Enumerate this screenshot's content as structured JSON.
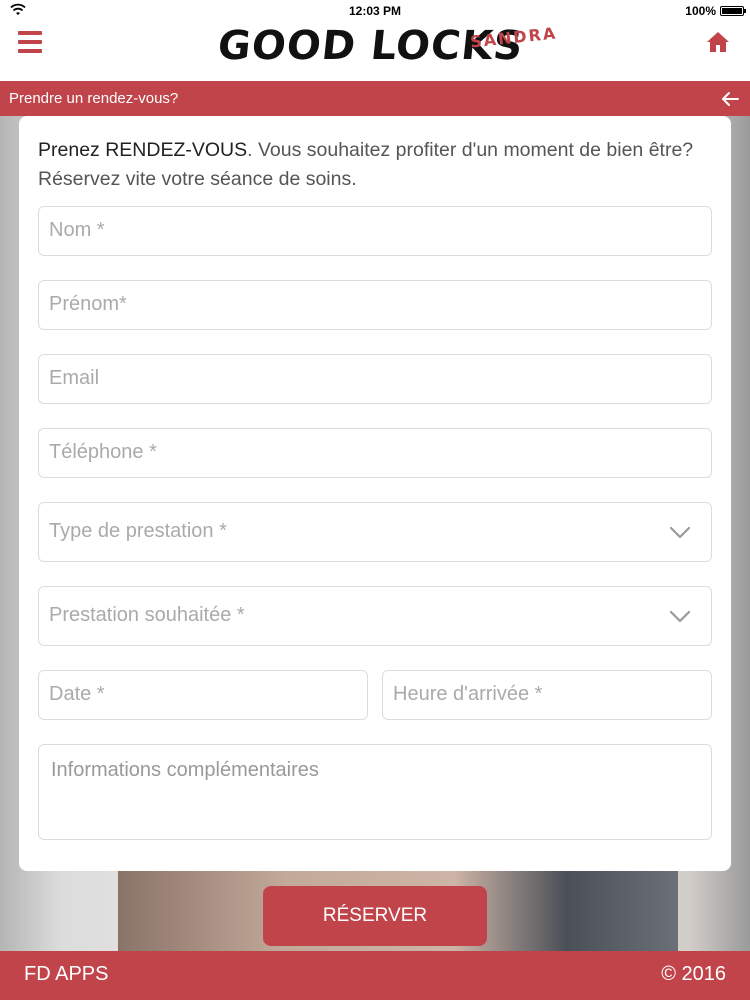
{
  "status_bar": {
    "time": "12:03 PM",
    "battery": "100%"
  },
  "header": {
    "logo_main": "GOOD LOCKS",
    "logo_sub": "SANDRA"
  },
  "title_bar": {
    "title": "Prendre un rendez-vous?"
  },
  "form": {
    "intro_strong": "Prenez RENDEZ-VOUS",
    "intro_rest": ". Vous souhaitez profiter d'un moment de bien être? Réservez vite votre séance de soins.",
    "fields": {
      "nom": "Nom *",
      "prenom": "Prénom*",
      "email": "Email",
      "telephone": "Téléphone *",
      "type_prestation": "Type de prestation *",
      "prestation_souhaitee": "Prestation souhaitée *",
      "date": "Date *",
      "heure": "Heure d'arrivée *",
      "informations": "Informations complémentaires"
    },
    "submit_label": "RÉSERVER"
  },
  "footer": {
    "left": "FD APPS",
    "right": "© 2016"
  },
  "colors": {
    "accent": "#c0444a",
    "field_border": "#dcdcdc",
    "placeholder": "#aaaaaa"
  },
  "icons": [
    "wifi-icon",
    "battery-icon",
    "menu-icon",
    "home-icon",
    "back-arrow-icon",
    "chevron-down-icon"
  ]
}
